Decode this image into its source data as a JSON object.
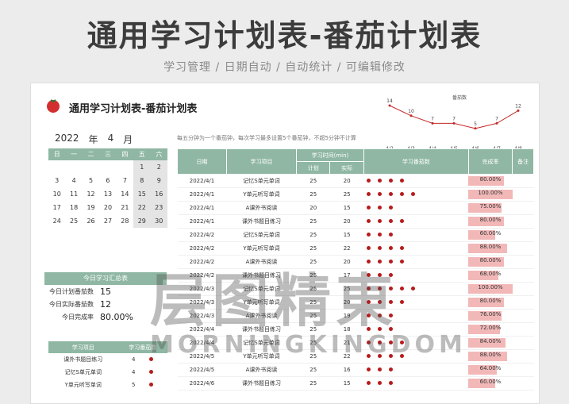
{
  "page_title": "通用学习计划表-番茄计划表",
  "subtitle": "学习管理 / 日期自动 / 自动统计 / 可编辑修改",
  "sheet_title": "通用学习计划表-番茄计划表",
  "chart": {
    "title": "番茄数",
    "values": [
      14,
      10,
      7,
      7,
      5,
      7,
      12
    ],
    "labels": [
      "4/2",
      "4/3",
      "4/4",
      "4/5",
      "4/6",
      "4/7",
      "4/8"
    ]
  },
  "calendar": {
    "year": "2022",
    "year_unit": "年",
    "month": "4",
    "month_unit": "月",
    "weekdays": [
      "日",
      "一",
      "二",
      "三",
      "四",
      "五",
      "六"
    ],
    "days": [
      [
        "",
        "",
        "",
        "",
        "",
        "1",
        "2"
      ],
      [
        "3",
        "4",
        "5",
        "6",
        "7",
        "8",
        "9"
      ],
      [
        "10",
        "11",
        "12",
        "13",
        "14",
        "15",
        "16"
      ],
      [
        "17",
        "18",
        "19",
        "20",
        "21",
        "22",
        "23"
      ],
      [
        "24",
        "25",
        "26",
        "27",
        "28",
        "29",
        "30"
      ]
    ]
  },
  "note": "每五分钟为一个番茄钟，每次学习最多设置5个番茄钟，不超5分钟不计算",
  "summary": {
    "header": "今日学习汇总表",
    "rows": [
      [
        "今日计划番茄数",
        "15"
      ],
      [
        "今日实际番茄数",
        "12"
      ],
      [
        "今日完成率",
        "80.00%"
      ]
    ]
  },
  "projects": {
    "headers": [
      "学习项目",
      "学习番茄数"
    ],
    "rows": [
      [
        "课外书题目练习",
        "4"
      ],
      [
        "记忆S单元单词",
        "4"
      ],
      [
        "Y单元听写单词",
        "5"
      ]
    ]
  },
  "table": {
    "headers": [
      "日期",
      "学习项目",
      "学习时间(min)",
      "学习番茄数",
      "完成率",
      "备注"
    ],
    "sub": [
      "计划",
      "实际"
    ],
    "rows": [
      [
        "2022/4/1",
        "记忆S单元单词",
        "25",
        "20",
        4,
        "80.00%",
        0.8
      ],
      [
        "2022/4/1",
        "Y单元听写单词",
        "25",
        "25",
        5,
        "100.00%",
        1
      ],
      [
        "2022/4/1",
        "A课外书阅读",
        "20",
        "15",
        3,
        "75.00%",
        0.75
      ],
      [
        "2022/4/1",
        "课外书题目练习",
        "25",
        "20",
        4,
        "80.00%",
        0.8
      ],
      [
        "2022/4/2",
        "记忆S单元单词",
        "25",
        "15",
        3,
        "60.00%",
        0.6
      ],
      [
        "2022/4/2",
        "Y单元听写单词",
        "25",
        "22",
        4,
        "88.00%",
        0.88
      ],
      [
        "2022/4/2",
        "A课外书阅读",
        "25",
        "20",
        4,
        "80.00%",
        0.8
      ],
      [
        "2022/4/2",
        "课外书题目练习",
        "25",
        "17",
        3,
        "68.00%",
        0.68
      ],
      [
        "2022/4/3",
        "记忆S单元单词",
        "25",
        "25",
        5,
        "100.00%",
        1
      ],
      [
        "2022/4/3",
        "Y单元听写单词",
        "25",
        "20",
        4,
        "80.00%",
        0.8
      ],
      [
        "2022/4/3",
        "A课外书阅读",
        "25",
        "19",
        3,
        "76.00%",
        0.76
      ],
      [
        "2022/4/4",
        "课外书题目练习",
        "25",
        "18",
        3,
        "72.00%",
        0.72
      ],
      [
        "2022/4/4",
        "记忆S单元单词",
        "25",
        "21",
        4,
        "84.00%",
        0.84
      ],
      [
        "2022/4/5",
        "Y单元听写单词",
        "25",
        "22",
        4,
        "88.00%",
        0.88
      ],
      [
        "2022/4/5",
        "A课外书阅读",
        "25",
        "16",
        3,
        "64.00%",
        0.64
      ],
      [
        "2022/4/6",
        "课外书题目练习",
        "25",
        "15",
        3,
        "60.00%",
        0.6
      ]
    ]
  },
  "watermark": "层图精東",
  "watermark2": "MORNINGKINGDOM",
  "colors": {
    "accent": "#8fb7a3",
    "dot": "#b71c1c"
  }
}
